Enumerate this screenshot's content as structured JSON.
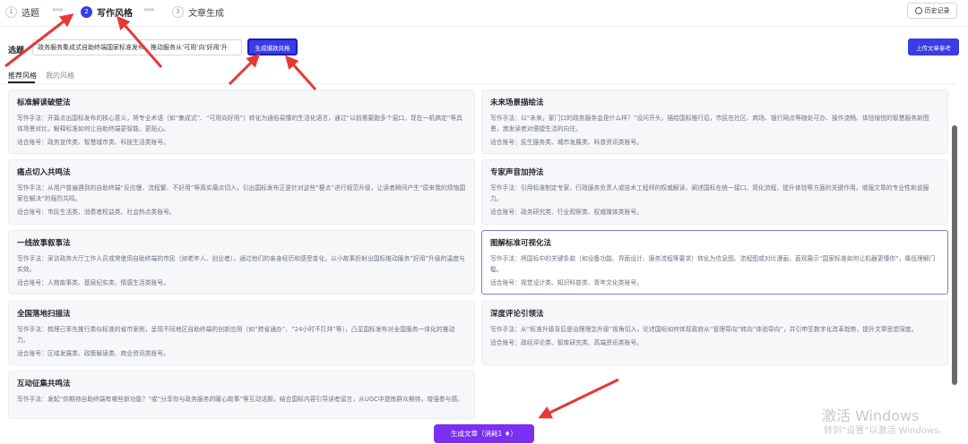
{
  "steps": [
    {
      "num": "1",
      "label": "选题"
    },
    {
      "num": "2",
      "label": "写作风格"
    },
    {
      "num": "3",
      "label": "文章生成"
    }
  ],
  "step_separator": "»»»",
  "history_label": "历史记录",
  "topic": {
    "label": "选题",
    "value": "政务服务集成式自助终端国家标准发布，推动服务从‘可用’向‘好用’升"
  },
  "generate_style_label": "生成爆款风格",
  "upload_label": "上传文章参考",
  "tabs": [
    "推荐风格",
    "我的风格"
  ],
  "cards": [
    {
      "title": "标准解读破壁法",
      "desc": "写作手法：开篇点出国标发布的核心意义，将专业术语（如“集成式”、“可用向好用”）转化为通俗易懂的生活化语言，通过“以前需要跑多个窗口，现在一机搞定”等具体场景对比，解释标准如何让自助终端更智能、更贴心。",
      "accounts": "适合账号：政务宣传类、智慧城市类、科技生活类账号。"
    },
    {
      "title": "未来场景描绘法",
      "desc": "写作手法：以“未来，家门口的政务服务会是什么样？”设问开头，描绘国标推行后，市民在社区、商场、银行网点等随处可办、操作流畅、体验愉悦的智慧服务新图景，激发读者对便捷生活的向往。",
      "accounts": "适合账号：民生服务类、城市发展类、科普资讯类账号。"
    },
    {
      "title": "痛点切入共鸣法",
      "desc": "写作手法：从用户普遍遇到的自助终端“反应慢、流程繁、不好用”等真实痛点切入，引出国标发布正是针对这些“梗点”进行规范升级，让读者瞬间产生“原来我的烦恼国家在解决”的强烈共鸣。",
      "accounts": "适合账号：市民生活类、消费者权益类、社会热点类账号。"
    },
    {
      "title": "专家声音加持法",
      "desc": "写作手法：引用标准制定专家、行政服务负责人或技术工程师的权威解读，阐述国标在统一接口、简化流程、提升体验等方面的关键作用，增强文章的专业性和说服力。",
      "accounts": "适合账号：政务研究类、行业观察类、权威媒体类账号。"
    },
    {
      "title": "一线故事叙事法",
      "desc": "写作手法：采访政务大厅工作人员或常使用自助终端的市民（如老年人、创业者），通过他们的亲身经历和感受变化，以小故事折射出国标推动服务“好用”升级的温度与实效。",
      "accounts": "适合账号：人物故事类、基层纪实类、情感生活类账号。"
    },
    {
      "title": "图解标准可视化法",
      "desc": "写作手法：将国标中的关键条款（如设备功能、界面设计、服务流程等要求）转化为信息图、流程图或对比漫画，直观展示“国家标准如何让机器更懂你”，降低理解门槛。",
      "accounts": "适合账号：视觉设计类、知识科普类、青年文化类账号。"
    },
    {
      "title": "全国落地扫描法",
      "desc": "写作手法：梳理已率先推行类似标准的省市案例，呈现不同地区自助终端的创新应用（如“跨省通办”、“24小时不打烊”等），凸显国标发布对全国服务一体化的推动力。",
      "accounts": "适合账号：区域发展类、政策解读类、商业资讯类账号。"
    },
    {
      "title": "深度评论引领法",
      "desc": "写作手法：从“标准升级背后是治理理念升级”视角切入，论述国标如何体现政府从“管理导向”转向“体验导向”，并引申至数字化改革趋势，提升文章思想深度。",
      "accounts": "适合账号：政经评论类、智库研究类、高端资讯类账号。"
    },
    {
      "title": "互动征集共鸣法",
      "desc": "写作手法：发起“你期待自助终端有哪些新功能？”或“分享你与政务服务的暖心故事”等互动话题，结合国标内容引导读者留言，从UGC中提炼群众期待，增强参与感。",
      "accounts": ""
    }
  ],
  "generate_article_label": "生成文章（消耗1 ♦）",
  "watermark": {
    "line1": "激活 Windows",
    "line2": "转到“设置”以激活 Windows。"
  },
  "colors": {
    "accent": "#3a3ce6",
    "purple": "#7b2ff2",
    "arrow": "#e53935"
  }
}
